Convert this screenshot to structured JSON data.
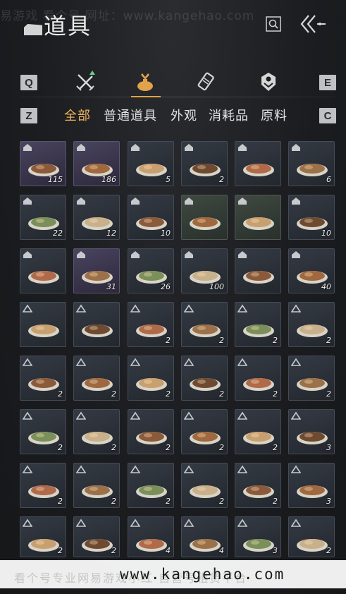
{
  "watermark_top": "易游戏   看个号   网址：www.kangehao.com",
  "header": {
    "title": "道具",
    "search_icon": "search-icon",
    "back_icon": "double-chevron-left-icon"
  },
  "category_tabs": {
    "left_key": "Q",
    "right_key": "E",
    "items": [
      {
        "icon": "crossed-swords-icon",
        "active": false
      },
      {
        "icon": "pouch-icon",
        "active": true
      },
      {
        "icon": "scroll-icon",
        "active": false
      },
      {
        "icon": "gem-icon",
        "active": false
      }
    ],
    "accent": "#e0a24a"
  },
  "sub_tabs": {
    "left_key": "Z",
    "right_key": "C",
    "items": [
      "全部",
      "普通道具",
      "外观",
      "消耗品",
      "原料"
    ],
    "active_index": 0
  },
  "items": [
    {
      "count": "115"
    },
    {
      "count": "186"
    },
    {
      "count": "5"
    },
    {
      "count": "2"
    },
    {
      "count": ""
    },
    {
      "count": "6"
    },
    {
      "count": "22"
    },
    {
      "count": "12"
    },
    {
      "count": "10"
    },
    {
      "count": ""
    },
    {
      "count": ""
    },
    {
      "count": "10"
    },
    {
      "count": ""
    },
    {
      "count": "31"
    },
    {
      "count": "26"
    },
    {
      "count": "100"
    },
    {
      "count": ""
    },
    {
      "count": "40"
    },
    {
      "count": ""
    },
    {
      "count": ""
    },
    {
      "count": "2"
    },
    {
      "count": "2"
    },
    {
      "count": "2"
    },
    {
      "count": "2"
    },
    {
      "count": "2"
    },
    {
      "count": "2"
    },
    {
      "count": "2"
    },
    {
      "count": "2"
    },
    {
      "count": "2"
    },
    {
      "count": "2"
    },
    {
      "count": "2"
    },
    {
      "count": "2"
    },
    {
      "count": "2"
    },
    {
      "count": "2"
    },
    {
      "count": "2"
    },
    {
      "count": "3"
    },
    {
      "count": "2"
    },
    {
      "count": "2"
    },
    {
      "count": "2"
    },
    {
      "count": "2"
    },
    {
      "count": "2"
    },
    {
      "count": "3"
    },
    {
      "count": "2"
    },
    {
      "count": "2"
    },
    {
      "count": "4"
    },
    {
      "count": "4"
    },
    {
      "count": "3"
    },
    {
      "count": "2"
    }
  ],
  "watermark_bottom": {
    "faded": "看个号专业网易游戏小红   自营号租赁平台",
    "url": "www.kangehao.com"
  }
}
